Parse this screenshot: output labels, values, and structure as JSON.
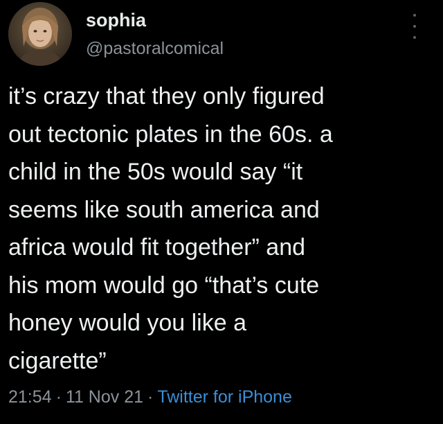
{
  "tweet": {
    "author": {
      "display_name": "sophia",
      "handle": "@pastoralcomical"
    },
    "text_lines": [
      "it’s crazy that they only figured",
      "out tectonic plates in the 60s. a",
      "child in the 50s would say “it",
      "seems like south america and",
      "africa would fit together” and",
      "his mom would go “that’s cute",
      "honey would you like a",
      "cigarette”"
    ],
    "time": "21:54",
    "separator": "·",
    "date": "11 Nov 21",
    "source": "Twitter for iPhone"
  },
  "icons": {
    "more": "more-options-icon",
    "avatar": "avatar"
  },
  "colors": {
    "background": "#000000",
    "text": "#e7e9ea",
    "muted": "#8b949a",
    "link": "#3b8ed6"
  }
}
